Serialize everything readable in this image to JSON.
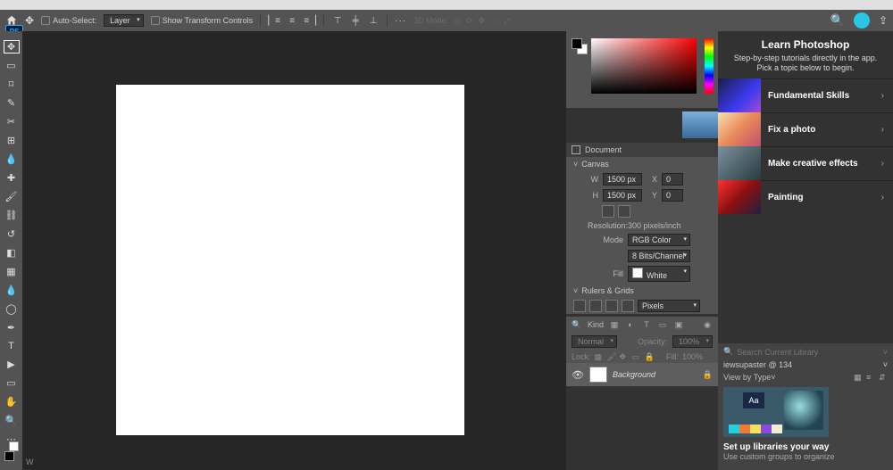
{
  "options": {
    "auto_select_label": "Auto-Select:",
    "layer_dd": "Layer",
    "show_transform_label": "Show Transform Controls",
    "more": "···",
    "mode_3d": "3D Mode:",
    "ps_badge": "PS"
  },
  "canvas": {
    "footer": "W"
  },
  "document_panel": {
    "title": "Document",
    "canvas_section": "Canvas",
    "width_label": "W",
    "width_val": "1500 px",
    "height_label": "H",
    "height_val": "1500 px",
    "x_label": "X",
    "x_val": "0",
    "y_label": "Y",
    "y_val": "0",
    "resolution_label": "Resolution:",
    "resolution_val": "300 pixels/inch",
    "mode_label": "Mode",
    "mode_val": "RGB Color",
    "bit_val": "8 Bits/Channel",
    "fill_label": "Fill",
    "fill_val": "White",
    "rulers_section": "Rulers & Grids",
    "units": "Pixels"
  },
  "layers": {
    "search_placeholder": "Kind",
    "blend": "Normal",
    "opacity_label": "Opacity:",
    "opacity_val": "100%",
    "lock_label": "Lock:",
    "fill_label": "Fill:",
    "fill_val": "100%",
    "layer_name": "Background"
  },
  "learn": {
    "title": "Learn Photoshop",
    "subtitle": "Step-by-step tutorials directly in the app. Pick a topic below to begin.",
    "cards": [
      {
        "label": "Fundamental Skills"
      },
      {
        "label": "Fix a photo"
      },
      {
        "label": "Make creative effects"
      },
      {
        "label": "Painting"
      }
    ]
  },
  "libraries": {
    "search_placeholder": "Search Current Library",
    "name": "iewsupaster @ 134",
    "view": "View by Type",
    "headline": "Set up libraries your way",
    "sub": "Use custom groups to organize",
    "preview_label": "Aa",
    "palette": [
      "#24d0e0",
      "#f07a3a",
      "#f6e060",
      "#8a4ae0",
      "#f0f0d0"
    ]
  }
}
